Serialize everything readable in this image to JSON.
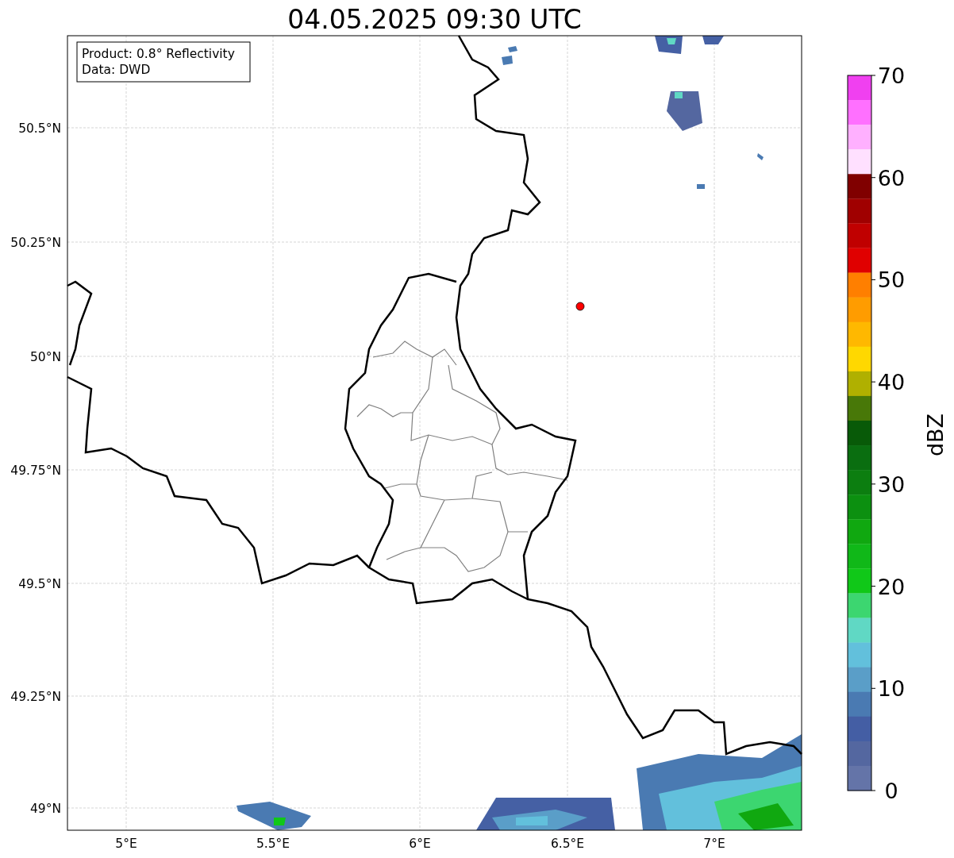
{
  "title": "04.05.2025 09:30 UTC",
  "info_box": [
    "Product: 0.8° Reflectivity",
    "Data: DWD"
  ],
  "y_ticks": [
    "50.5°N",
    "50.25°N",
    "50°N",
    "49.75°N",
    "49.5°N",
    "49.25°N",
    "49°N"
  ],
  "x_ticks": [
    "5°E",
    "5.5°E",
    "6°E",
    "6.5°E",
    "7°E"
  ],
  "colorbar": {
    "label": "dBZ",
    "ticks": [
      "70",
      "60",
      "50",
      "40",
      "30",
      "20",
      "10",
      "0"
    ],
    "bins": [
      {
        "color": "#f040f0"
      },
      {
        "color": "#ff70ff"
      },
      {
        "color": "#ffb0ff"
      },
      {
        "color": "#ffe0ff"
      },
      {
        "color": "#800000"
      },
      {
        "color": "#a00000"
      },
      {
        "color": "#c00000"
      },
      {
        "color": "#e00000"
      },
      {
        "color": "#ff7f00"
      },
      {
        "color": "#ff9c00"
      },
      {
        "color": "#ffb800"
      },
      {
        "color": "#ffd800"
      },
      {
        "color": "#b0b000"
      },
      {
        "color": "#487808"
      },
      {
        "color": "#085a08"
      },
      {
        "color": "#0a6e10"
      },
      {
        "color": "#0c7e10"
      },
      {
        "color": "#0c9010"
      },
      {
        "color": "#10a810"
      },
      {
        "color": "#10b818"
      },
      {
        "color": "#10c818"
      },
      {
        "color": "#3cd670"
      },
      {
        "color": "#60d8c4"
      },
      {
        "color": "#62c0dc"
      },
      {
        "color": "#5a9ec8"
      },
      {
        "color": "#4a7ab2"
      },
      {
        "color": "#445ea4"
      },
      {
        "color": "#5467a0"
      },
      {
        "color": "#6474a8"
      }
    ]
  }
}
